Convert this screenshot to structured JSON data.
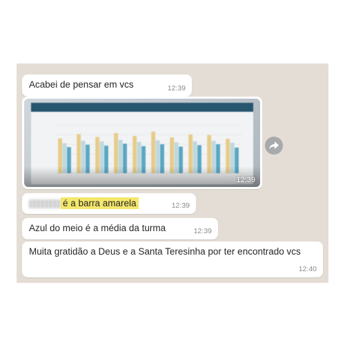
{
  "messages": [
    {
      "text": "Acabei de pensar em vcs",
      "time": "12:39"
    },
    {
      "type": "image",
      "time": "12:39"
    },
    {
      "text_highlight": "é a barra amarela",
      "time": "12:39"
    },
    {
      "text": "Azul do meio é a média da turma",
      "time": "12:39"
    },
    {
      "text": "Muita gratidão a Deus e a Santa Teresinha por ter encontrado vcs",
      "time": "12:40"
    }
  ],
  "icons": {
    "forward": "forward-arrow-icon"
  },
  "colors": {
    "chat_background": "#e4ddd5",
    "bubble": "#ffffff",
    "highlight": "#f4e76b",
    "chart_yellow_bar": "#e7cc8a",
    "chart_blue_bar": "#5aa7c2",
    "chart_light_bar": "#bfd7de"
  },
  "chart_data": {
    "type": "bar",
    "groups": 10,
    "series": [
      {
        "values": [
          7.2,
          8.1,
          7.5,
          8.3,
          7.7,
          8.6,
          7.4,
          8.0,
          7.9,
          7.1
        ]
      },
      {
        "values": [
          6.2,
          6.7,
          6.6,
          6.9,
          6.5,
          6.8,
          6.4,
          6.6,
          6.7,
          6.3
        ]
      },
      {
        "values": [
          5.4,
          5.9,
          5.7,
          6.1,
          5.6,
          6.0,
          5.5,
          5.8,
          6.0,
          5.3
        ]
      }
    ],
    "ylim": [
      0,
      10
    ]
  }
}
